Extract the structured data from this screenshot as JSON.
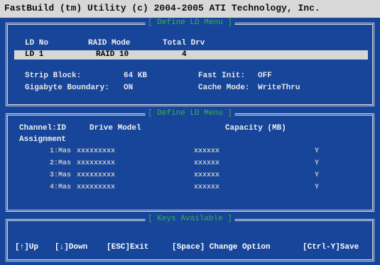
{
  "titlebar": {
    "title": "FastBuild (tm) Utility (c) 2004-2005 ATI Technology, Inc."
  },
  "ld_panel": {
    "title": "[ Define LD Menu ]",
    "columns": [
      "LD No",
      "RAID Mode",
      "Total Drv"
    ],
    "selected_row": {
      "ld_no": "LD 1",
      "raid_mode": "RAID 10",
      "total_drv": "4"
    },
    "strip_block_label": "Strip Block:",
    "strip_block_value": "64 KB",
    "fast_init_label": "Fast Init:",
    "fast_init_value": "OFF",
    "gigabyte_label": "Gigabyte Boundary:",
    "gigabyte_value": "ON",
    "cache_label": "Cache Mode:",
    "cache_value": "WriteThru"
  },
  "drive_panel": {
    "title": "[ Define LD Menu ]",
    "col_channel": "Channel:ID",
    "col_model": "Drive Model",
    "col_capacity": "Capacity (MB)",
    "assignment_label": "Assignment",
    "rows": [
      {
        "channel": "1:Mas",
        "model": "xxxxxxxxx",
        "capacity": "xxxxxx",
        "assign": "Y"
      },
      {
        "channel": "2:Mas",
        "model": "xxxxxxxxx",
        "capacity": "xxxxxx",
        "assign": "Y"
      },
      {
        "channel": "3:Mas",
        "model": "xxxxxxxxx",
        "capacity": "xxxxxx",
        "assign": "Y"
      },
      {
        "channel": "4:Mas",
        "model": "xxxxxxxxx",
        "capacity": "xxxxxx",
        "assign": "Y"
      }
    ]
  },
  "keys_panel": {
    "title": "[ Keys Available ]",
    "up": "[↑]Up",
    "down": "[↓]Down",
    "exit": "[ESC]Exit",
    "change": "[Space] Change Option",
    "save": "[Ctrl-Y]Save"
  }
}
